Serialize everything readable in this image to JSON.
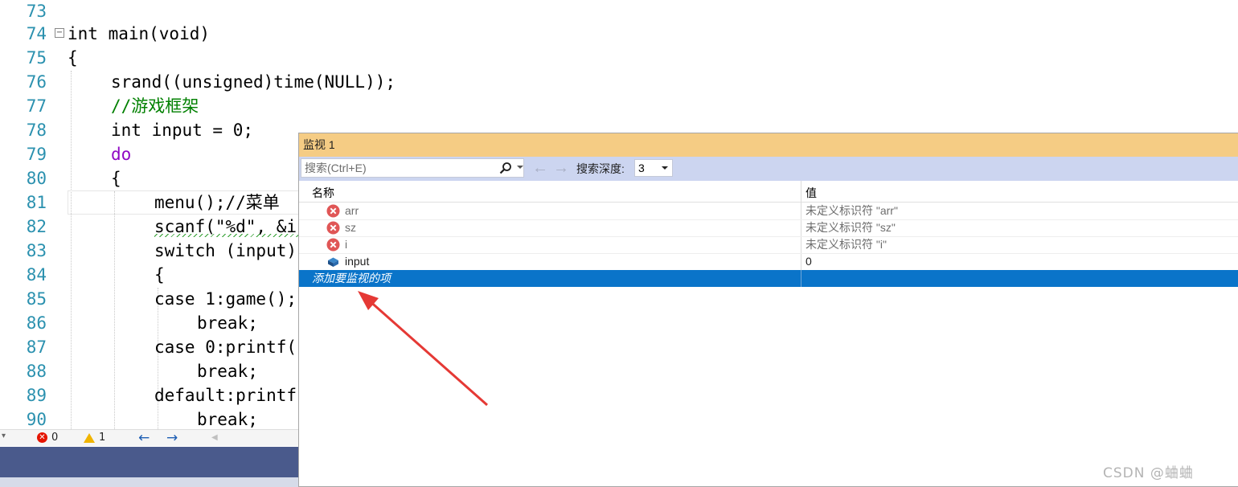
{
  "code_editor": {
    "lines": [
      {
        "num": "73"
      },
      {
        "num": "74",
        "text": "int main(void)"
      },
      {
        "num": "75",
        "text": "{"
      },
      {
        "num": "76",
        "text": "srand((unsigned)time(NULL));"
      },
      {
        "num": "77",
        "text": "//游戏框架"
      },
      {
        "num": "78",
        "text": "int input = 0;"
      },
      {
        "num": "79",
        "text": "do"
      },
      {
        "num": "80",
        "text": "{"
      },
      {
        "num": "81",
        "text": "menu();//菜单"
      },
      {
        "num": "82",
        "text": "scanf(\"%d\", &i"
      },
      {
        "num": "83",
        "text": "switch (input)"
      },
      {
        "num": "84",
        "text": "{"
      },
      {
        "num": "85",
        "text": "case 1:game();"
      },
      {
        "num": "86",
        "text": "break;"
      },
      {
        "num": "87",
        "text": "case 0:printf("
      },
      {
        "num": "88",
        "text": "break;"
      },
      {
        "num": "89",
        "text": "default:printf"
      },
      {
        "num": "90",
        "text": "break;"
      }
    ]
  },
  "status_bar": {
    "errors": "0",
    "warnings": "1"
  },
  "watch_window": {
    "title": "监视 1",
    "search_placeholder": "搜索(Ctrl+E)",
    "depth_label": "搜索深度:",
    "depth_value": "3",
    "columns": {
      "name": "名称",
      "value": "值"
    },
    "rows": [
      {
        "name": "arr",
        "value": "未定义标识符 \"arr\"",
        "icon": "error-icon"
      },
      {
        "name": "sz",
        "value": "未定义标识符 \"sz\"",
        "icon": "error-icon"
      },
      {
        "name": "i",
        "value": "未定义标识符 \"i\"",
        "icon": "error-icon"
      },
      {
        "name": "input",
        "value": "0",
        "icon": "variable-icon"
      }
    ],
    "add_item_placeholder": "添加要监视的项"
  },
  "annotation": {
    "arrow_color": "#e53935"
  },
  "watermark": "CSDN @蛐蛐"
}
